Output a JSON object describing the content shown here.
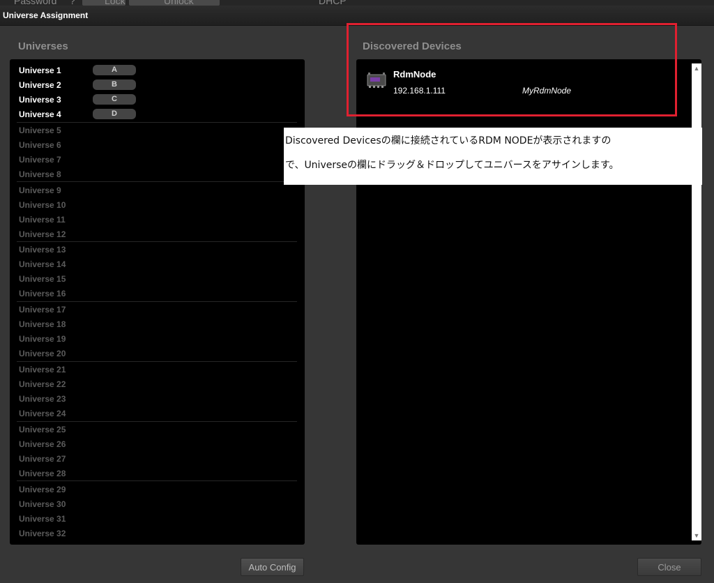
{
  "background_window": {
    "fragments": [
      "Password",
      "?",
      "Lock",
      "Unlock",
      "DHCP"
    ]
  },
  "dialog": {
    "title": "Universe Assignment"
  },
  "universes": {
    "heading": "Universes",
    "items": [
      {
        "label": "Universe 1",
        "badge": "A",
        "active": true
      },
      {
        "label": "Universe 2",
        "badge": "B",
        "active": true
      },
      {
        "label": "Universe 3",
        "badge": "C",
        "active": true
      },
      {
        "label": "Universe 4",
        "badge": "D",
        "active": true
      },
      {
        "label": "Universe 5",
        "badge": "",
        "active": false
      },
      {
        "label": "Universe 6",
        "badge": "",
        "active": false
      },
      {
        "label": "Universe 7",
        "badge": "",
        "active": false
      },
      {
        "label": "Universe 8",
        "badge": "",
        "active": false
      },
      {
        "label": "Universe 9",
        "badge": "",
        "active": false
      },
      {
        "label": "Universe 10",
        "badge": "",
        "active": false
      },
      {
        "label": "Universe 11",
        "badge": "",
        "active": false
      },
      {
        "label": "Universe 12",
        "badge": "",
        "active": false
      },
      {
        "label": "Universe 13",
        "badge": "",
        "active": false
      },
      {
        "label": "Universe 14",
        "badge": "",
        "active": false
      },
      {
        "label": "Universe 15",
        "badge": "",
        "active": false
      },
      {
        "label": "Universe 16",
        "badge": "",
        "active": false
      },
      {
        "label": "Universe 17",
        "badge": "",
        "active": false
      },
      {
        "label": "Universe 18",
        "badge": "",
        "active": false
      },
      {
        "label": "Universe 19",
        "badge": "",
        "active": false
      },
      {
        "label": "Universe 20",
        "badge": "",
        "active": false
      },
      {
        "label": "Universe 21",
        "badge": "",
        "active": false
      },
      {
        "label": "Universe 22",
        "badge": "",
        "active": false
      },
      {
        "label": "Universe 23",
        "badge": "",
        "active": false
      },
      {
        "label": "Universe 24",
        "badge": "",
        "active": false
      },
      {
        "label": "Universe 25",
        "badge": "",
        "active": false
      },
      {
        "label": "Universe 26",
        "badge": "",
        "active": false
      },
      {
        "label": "Universe 27",
        "badge": "",
        "active": false
      },
      {
        "label": "Universe 28",
        "badge": "",
        "active": false
      },
      {
        "label": "Universe 29",
        "badge": "",
        "active": false
      },
      {
        "label": "Universe 30",
        "badge": "",
        "active": false
      },
      {
        "label": "Universe 31",
        "badge": "",
        "active": false
      },
      {
        "label": "Universe 32",
        "badge": "",
        "active": false
      }
    ]
  },
  "devices": {
    "heading": "Discovered Devices",
    "items": [
      {
        "name": "RdmNode",
        "ip": "192.168.1.111",
        "label": "MyRdmNode",
        "icon": "rdm-node-device-icon"
      }
    ]
  },
  "annotation": {
    "line1": "Discovered Devicesの欄に接続されているRDM NODEが表示されますの",
    "line2": "で、Universeの欄にドラッグ＆ドロップしてユニバースをアサインします。",
    "highlight_color": "#e02030"
  },
  "buttons": {
    "auto_config": "Auto Config",
    "close": "Close"
  },
  "scrollbar": {
    "up": "▲",
    "down": "▼"
  }
}
